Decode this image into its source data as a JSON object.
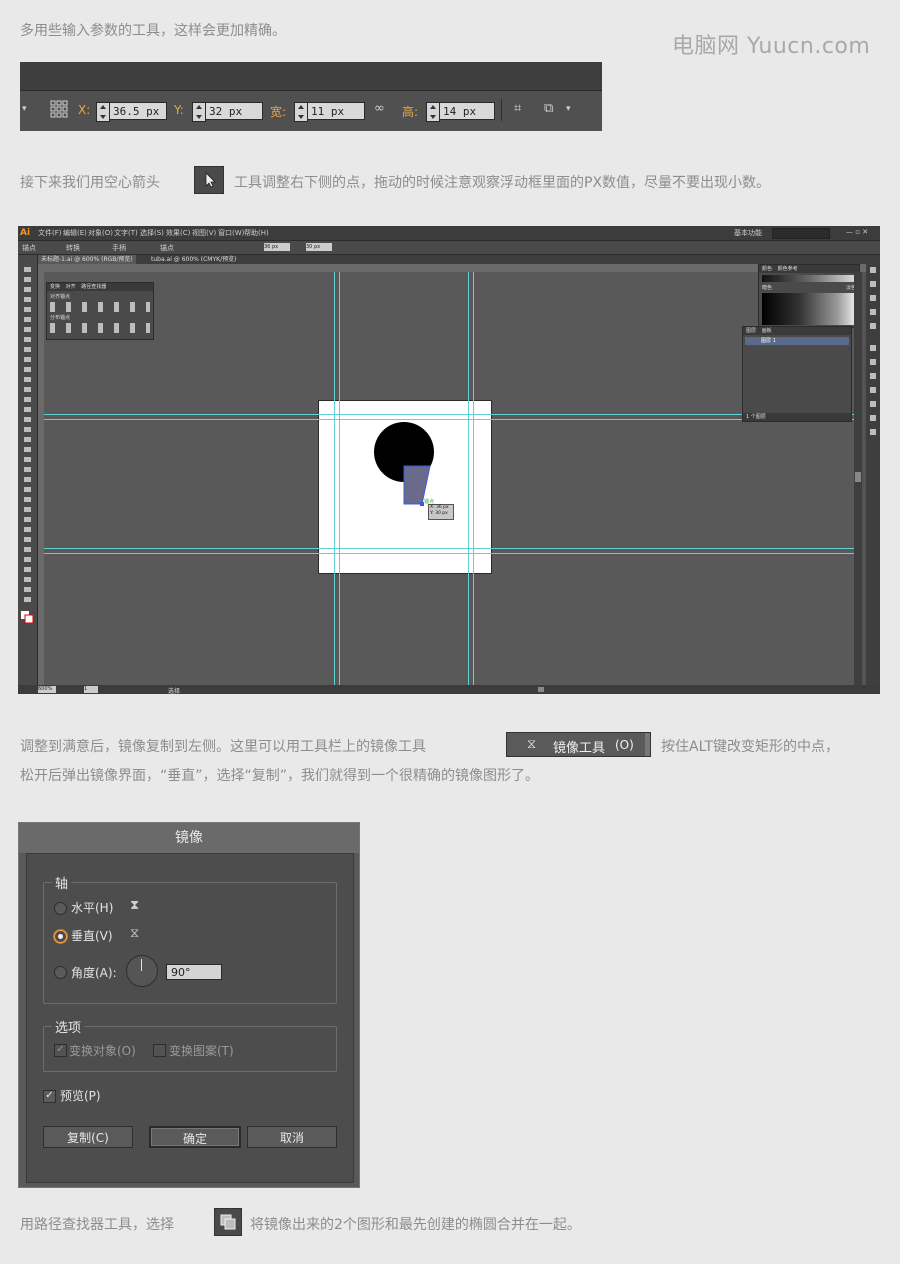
{
  "paragraphs": {
    "p1": "多用些输入参数的工具，这样会更加精确。",
    "p2a": "接下来我们用空心箭头",
    "p2b": "工具调整右下侧的点，拖动的时候注意观察浮动框里面的PX数值，尽量不要出现小数。",
    "p3a": "调整到满意后，镜像复制到左侧。这里可以用工具栏上的镜像工具",
    "p3b": "按住ALT键改变矩形的中点，",
    "p3c": "松开后弹出镜像界面，“垂直”，选择“复制”，我们就得到一个很精确的镜像图形了。",
    "p4a": "用路径查找器工具，选择",
    "p4b": "将镜像出来的2个图形和最先创建的椭圆合并在一起。"
  },
  "watermark": "电脑网 Yuucn.com",
  "toolbar": {
    "x_label": "X:",
    "x_value": "36.5 px",
    "y_label": "Y:",
    "y_value": "32 px",
    "w_label": "宽:",
    "w_value": "11 px",
    "h_label": "高:",
    "h_value": "14 px"
  },
  "reflect_tool": {
    "label": "镜像工具",
    "shortcut": "(O)"
  },
  "illustrator": {
    "logo": "Ai",
    "menus": [
      "文件(F)",
      "编辑(E)",
      "对象(O)",
      "文字(T)",
      "选择(S)",
      "效果(C)",
      "视图(V)",
      "窗口(W)",
      "帮助(H)"
    ],
    "workspace": "基本功能",
    "control_label": "锚点",
    "control_convert": "转换",
    "control_handle": "手柄",
    "control_anchor": "锚点",
    "control_x": "36 px",
    "control_y": "30 px",
    "tabs": [
      "未标题-1.ai @ 600% (RGB/预览)",
      "tuba.ai @ 600% (CMYK/预览)"
    ],
    "ruler_ticks": [
      "96",
      "4",
      "8",
      "12",
      "16",
      "20",
      "24",
      "0",
      "8",
      "12",
      "16",
      "20",
      "24",
      "28",
      "32",
      "36",
      "40",
      "44",
      "48",
      "52",
      "56",
      "60",
      "144"
    ],
    "align_panel": {
      "tab1": "变换",
      "tab2": "对齐",
      "tab3": "路径查找器",
      "section1": "对齐锚点",
      "section2": "分布锚点"
    },
    "swatches_panel": {
      "tab1": "颜色",
      "tab2": "颜色参考",
      "label_left": "暗色",
      "label_right": "淡色"
    },
    "layers_panel": {
      "tab1": "图层",
      "tab2": "画板",
      "layer_name": "图层 1",
      "footer": "1 个图层"
    },
    "tooltip_x": "X: 36 px",
    "tooltip_y": "Y: 30 px",
    "anchor_hint": "锚点",
    "zoom": "600%",
    "page": "1",
    "status": "选择"
  },
  "dialog": {
    "title": "镜像",
    "axis_group": "轴",
    "horizontal": "水平(H)",
    "vertical": "垂直(V)",
    "angle": "角度(A):",
    "angle_value": "90°",
    "options_group": "选项",
    "transform_objects": "变换对象(O)",
    "transform_patterns": "变换图案(T)",
    "preview": "预览(P)",
    "copy_btn": "复制(C)",
    "ok_btn": "确定",
    "cancel_btn": "取消"
  }
}
